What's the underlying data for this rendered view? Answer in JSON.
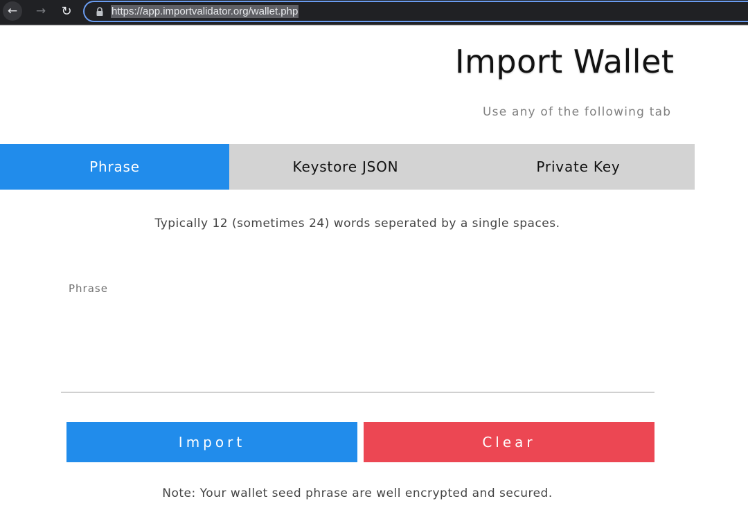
{
  "browser": {
    "back_icon": "arrow-left-icon",
    "forward_icon": "arrow-right-icon",
    "reload_icon": "reload-icon",
    "lock_icon": "lock-icon",
    "url": "https://app.importvalidator.org/wallet.php"
  },
  "page": {
    "title": "Import Wallet",
    "subtitle": "Use any of the following tab"
  },
  "tabs": [
    {
      "label": "Phrase",
      "active": true
    },
    {
      "label": "Keystore JSON",
      "active": false
    },
    {
      "label": "Private Key",
      "active": false
    }
  ],
  "form": {
    "hint": "Typically 12 (sometimes 24) words seperated by a single spaces.",
    "phrase_label": "Phrase",
    "phrase_value": "",
    "import_label": "Import",
    "clear_label": "Clear"
  },
  "note": "Note: Your wallet seed phrase are well encrypted and secured.",
  "colors": {
    "primary": "#218ceb",
    "danger": "#ec4753",
    "tab_inactive": "#d3d3d3"
  }
}
